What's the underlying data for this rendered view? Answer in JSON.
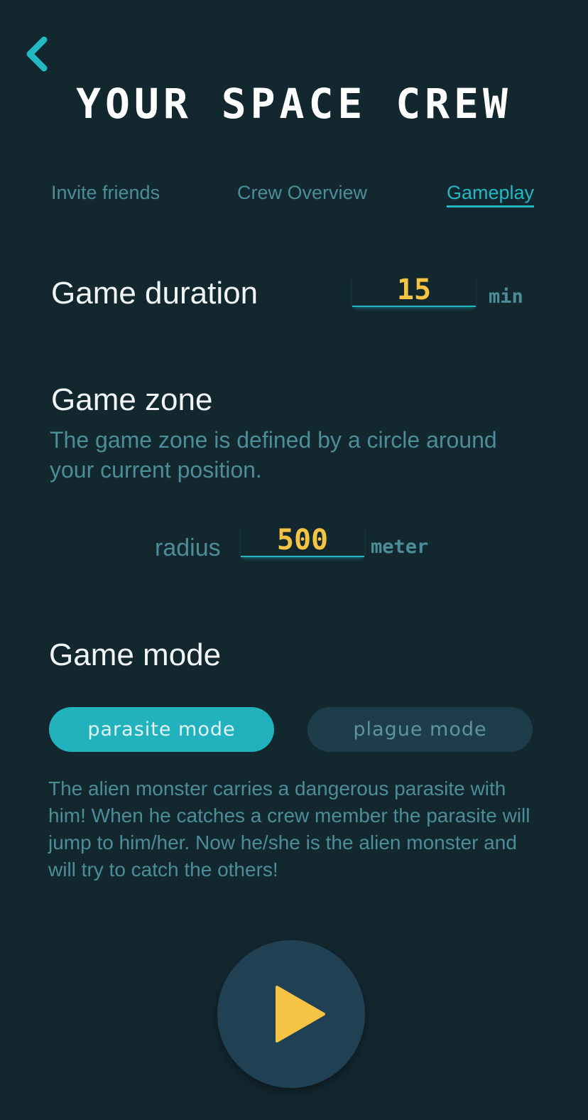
{
  "header": {
    "back_icon": "chevron-left-icon",
    "title": "YOUR SPACE CREW"
  },
  "tabs": [
    {
      "label": "Invite friends",
      "active": false
    },
    {
      "label": "Crew Overview",
      "active": false
    },
    {
      "label": "Gameplay",
      "active": true
    }
  ],
  "duration": {
    "heading": "Game duration",
    "value": "15",
    "unit": "min"
  },
  "zone": {
    "heading": "Game zone",
    "description": "The game zone is defined by a circle around your current position.",
    "radius_label": "radius",
    "radius_value": "500",
    "radius_unit": "meter"
  },
  "mode": {
    "heading": "Game mode",
    "options": [
      {
        "label": "parasite mode",
        "selected": true
      },
      {
        "label": "plague mode",
        "selected": false
      }
    ],
    "description": "The alien monster carries a dangerous parasite with him! When he catches a crew member the parasite will jump to him/her. Now he/she is the alien monster and will try to catch the others!"
  },
  "play_icon": "play-icon",
  "colors": {
    "background": "#13272f",
    "accent": "#22b8c4",
    "highlight": "#f6c444",
    "muted": "#4c8d98"
  }
}
